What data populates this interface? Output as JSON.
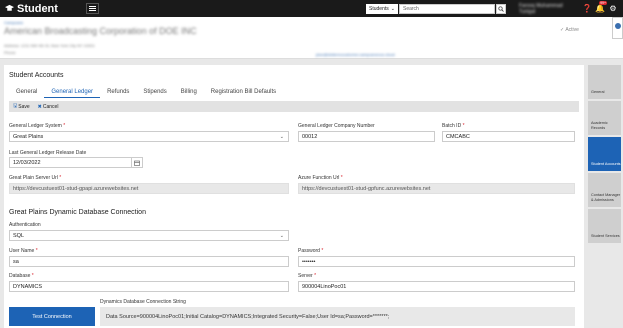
{
  "topbar": {
    "app_title": "Student",
    "search_scope": "Students",
    "search_placeholder": "Search",
    "user_name": "Farooq Muhammad Tunigal",
    "notification_count": "99+"
  },
  "header": {
    "breadcrumb": "Campuses",
    "org_name": "American Broadcasting Corporation of DOE INC",
    "address": "Address: 1211 NW 4th St, New York City NY 10001",
    "phone": "Phone",
    "email": "jdoe@dddemocustomer.campusnexus.cloud",
    "status": "Active"
  },
  "panel": {
    "title": "Student Accounts",
    "tabs": [
      "General",
      "General Ledger",
      "Refunds",
      "Stipends",
      "Billing",
      "Registration Bill Defaults"
    ],
    "active_tab": "General Ledger",
    "toolbar": {
      "save": "Save",
      "cancel": "Cancel"
    },
    "fields": {
      "gl_system_label": "General Ledger System",
      "gl_system_value": "Great Plains",
      "gl_company_label": "General Ledger Company Number",
      "gl_company_value": "00012",
      "batch_id_label": "Batch ID",
      "batch_id_value": "CMCABC",
      "release_date_label": "Last General Ledger Release Date",
      "release_date_value": "12/03/2022",
      "gp_server_label": "Great Plain Server Url",
      "gp_server_value": "https://devcustuest01-stud-gpapi.azurewebsites.net",
      "azure_fn_label": "Azure Function Url",
      "azure_fn_value": "https://devcustuest01-stud-gpfunc.azurewebsites.net"
    },
    "db_section": {
      "title": "Great Plains Dynamic Database Connection",
      "auth_label": "Authentication",
      "auth_value": "SQL",
      "username_label": "User Name",
      "username_value": "sa",
      "password_label": "Password",
      "password_value": "•••••••",
      "database_label": "Database",
      "database_value": "DYNAMICS",
      "server_label": "Server",
      "server_value": "900004LinoPoc01",
      "conn_label": "Dynamics Database Connection String",
      "conn_value": "Data Source=900004LinoPoc01;Initial Catalog=DYNAMICS;Integrated Security=False;User Id=sa;Password=*******;",
      "test_button": "Test Connection"
    }
  },
  "right_nav": [
    "General",
    "Academic Records",
    "Student Accounts",
    "Contact Manager & Admissions",
    "Student Services"
  ],
  "colors": {
    "accent": "#1d63b5",
    "topbar": "#1a1a1a",
    "required": "#d9232d"
  }
}
